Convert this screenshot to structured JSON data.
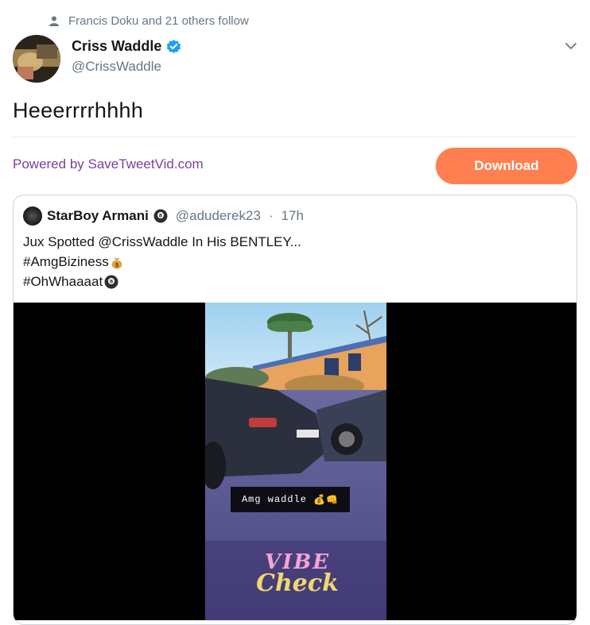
{
  "social_context": {
    "text": "Francis Doku and 21 others follow",
    "icon": "person-icon"
  },
  "author": {
    "name": "Criss Waddle",
    "handle": "@CrissWaddle",
    "verified": true
  },
  "tweet": {
    "text": "Heeerrrrhhhh"
  },
  "extension": {
    "powered_by": "Powered by SaveTweetVid.com",
    "download_label": "Download",
    "accent": "#ff7f50",
    "link_color": "#7b3fa0"
  },
  "quoted": {
    "name": "StarBoy Armani",
    "handle": "@aduderek23",
    "separator": "·",
    "time": "17h",
    "line1": "Jux Spotted @CrissWaddle In His BENTLEY...",
    "line2": "#AmgBiziness",
    "line3": "#OhWhaaaat"
  },
  "video": {
    "caption": "Amg waddle",
    "sticker_line1": "VIBE",
    "sticker_line2": "Check"
  },
  "colors": {
    "verified": "#1da1f2",
    "text": "#14171a",
    "muted": "#657786",
    "border": "#ccd6dd"
  }
}
